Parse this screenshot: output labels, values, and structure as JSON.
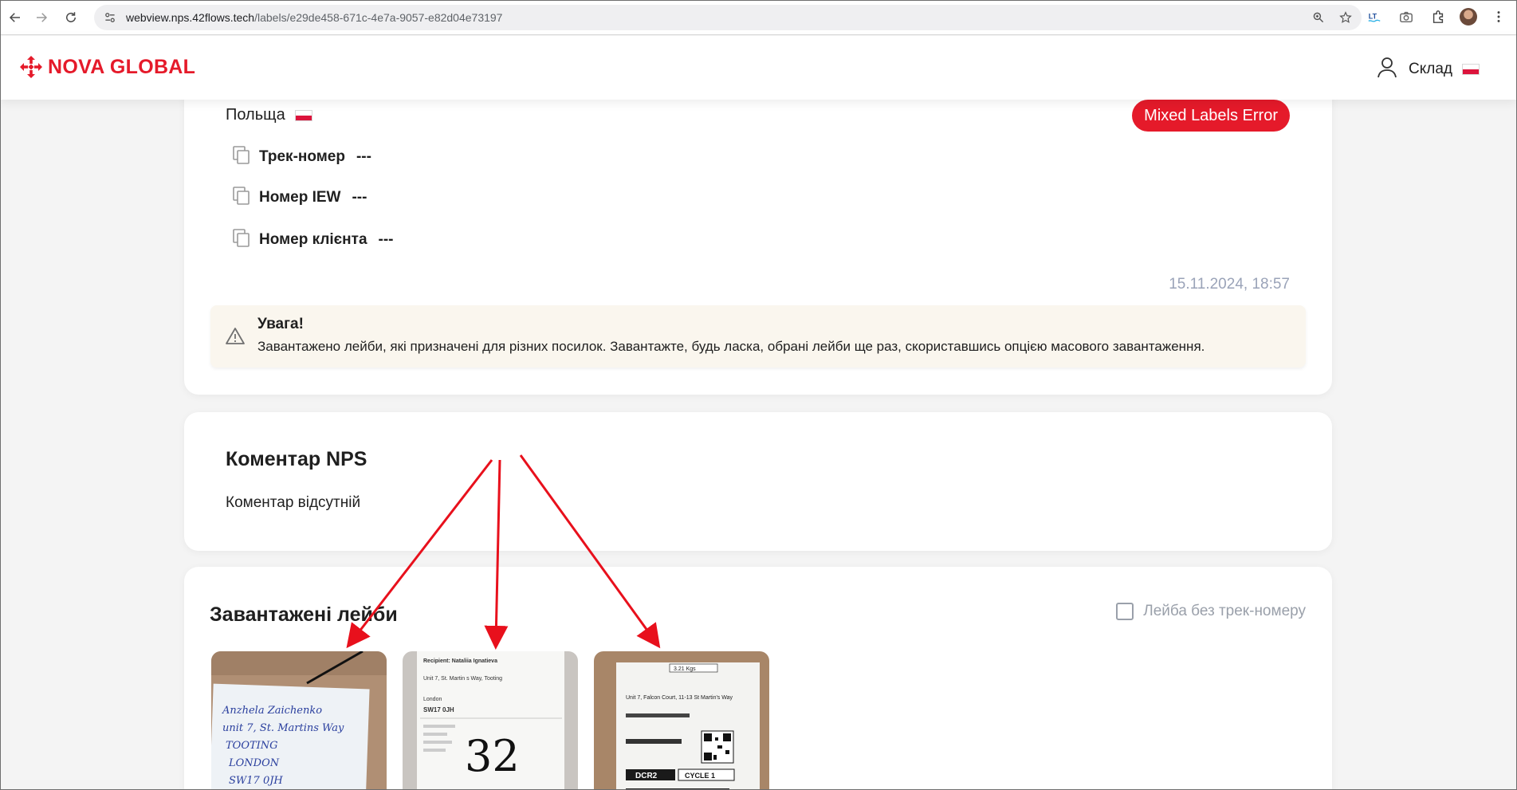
{
  "browser": {
    "url_host": "webview.nps.42flows.tech",
    "url_path": "/labels/e29de458-671c-4e7a-9057-e82d04e73197"
  },
  "header": {
    "logo_text": "NOVA GLOBAL",
    "user_label": "Склад",
    "brand_color": "#e51a2a"
  },
  "parcel": {
    "country": "Польща",
    "error_badge": "Mixed Labels Error",
    "fields": [
      {
        "label": "Трек-номер",
        "value": "---"
      },
      {
        "label": "Номер IEW",
        "value": "---"
      },
      {
        "label": "Номер клієнта",
        "value": "---"
      }
    ],
    "timestamp": "15.11.2024, 18:57",
    "warning": {
      "title": "Увага!",
      "text": "Завантажено лейби, які призначені для різних посилок. Завантажте, будь ласка, обрані лейби ще раз, скориставшись опцією масового завантаження."
    }
  },
  "comment": {
    "title": "Коментар NPS",
    "text": "Коментар відсутній"
  },
  "labels": {
    "title": "Завантажені лейби",
    "checkbox_label": "Лейба без трек-номеру",
    "checkbox_checked": false,
    "images": [
      {
        "lines": [
          "Anzhela Zaichenko",
          "unit 7, St. Martins Way",
          "TOOTING",
          "LONDON",
          "SW17 0JH"
        ]
      },
      {
        "recipient": "Recipient: Nataliia Ignatieva",
        "address": "Unit 7, St. Martin s Way, Tooting",
        "city": "London",
        "postcode": "SW17 0JH",
        "handwritten": "32"
      },
      {
        "top_code": "3.21 Kgs",
        "address": "Unit 7, Falcon Court, 11-13 St Martin's Way",
        "code1": "DCR2",
        "code2": "CYCLE 1"
      }
    ]
  }
}
